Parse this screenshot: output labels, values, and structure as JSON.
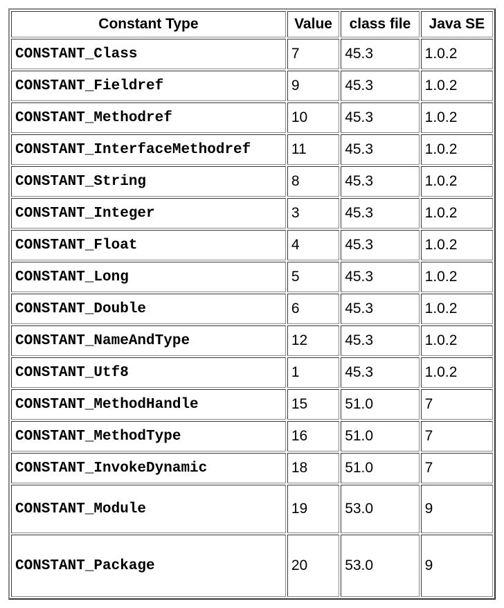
{
  "headers": {
    "constant_type": "Constant Type",
    "value": "Value",
    "class_file": "class file",
    "java_se": "Java SE"
  },
  "rows": [
    {
      "constant_type": "CONSTANT_Class",
      "value": "7",
      "class_file": "45.3",
      "java_se": "1.0.2"
    },
    {
      "constant_type": "CONSTANT_Fieldref",
      "value": "9",
      "class_file": "45.3",
      "java_se": "1.0.2"
    },
    {
      "constant_type": "CONSTANT_Methodref",
      "value": "10",
      "class_file": "45.3",
      "java_se": "1.0.2"
    },
    {
      "constant_type": "CONSTANT_InterfaceMethodref",
      "value": "11",
      "class_file": "45.3",
      "java_se": "1.0.2"
    },
    {
      "constant_type": "CONSTANT_String",
      "value": "8",
      "class_file": "45.3",
      "java_se": "1.0.2"
    },
    {
      "constant_type": "CONSTANT_Integer",
      "value": "3",
      "class_file": "45.3",
      "java_se": "1.0.2"
    },
    {
      "constant_type": "CONSTANT_Float",
      "value": "4",
      "class_file": "45.3",
      "java_se": "1.0.2"
    },
    {
      "constant_type": "CONSTANT_Long",
      "value": "5",
      "class_file": "45.3",
      "java_se": "1.0.2"
    },
    {
      "constant_type": "CONSTANT_Double",
      "value": "6",
      "class_file": "45.3",
      "java_se": "1.0.2"
    },
    {
      "constant_type": "CONSTANT_NameAndType",
      "value": "12",
      "class_file": "45.3",
      "java_se": "1.0.2"
    },
    {
      "constant_type": "CONSTANT_Utf8",
      "value": "1",
      "class_file": "45.3",
      "java_se": "1.0.2"
    },
    {
      "constant_type": "CONSTANT_MethodHandle",
      "value": "15",
      "class_file": "51.0",
      "java_se": "7"
    },
    {
      "constant_type": "CONSTANT_MethodType",
      "value": "16",
      "class_file": "51.0",
      "java_se": "7"
    },
    {
      "constant_type": "CONSTANT_InvokeDynamic",
      "value": "18",
      "class_file": "51.0",
      "java_se": "7"
    },
    {
      "constant_type": "CONSTANT_Module",
      "value": "19",
      "class_file": "53.0",
      "java_se": "9"
    },
    {
      "constant_type": "CONSTANT_Package",
      "value": "20",
      "class_file": "53.0",
      "java_se": "9"
    }
  ]
}
